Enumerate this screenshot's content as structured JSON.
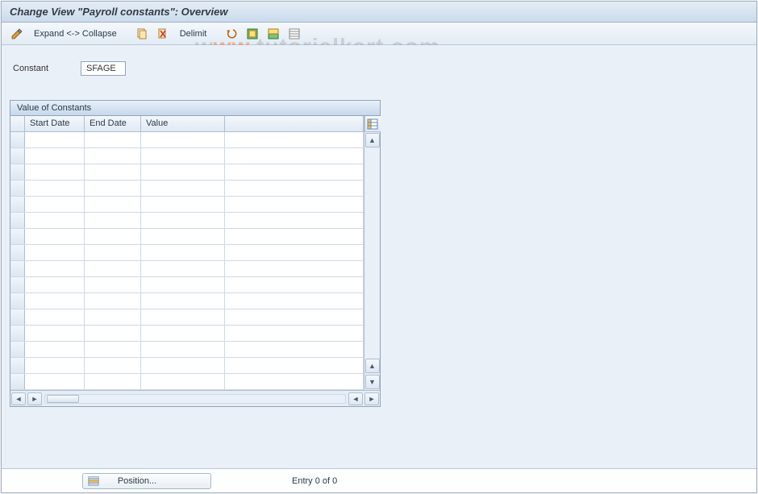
{
  "header": {
    "title": "Change View \"Payroll constants\": Overview"
  },
  "toolbar": {
    "expand_collapse": "Expand <-> Collapse",
    "delimit": "Delimit"
  },
  "field": {
    "constant_label": "Constant",
    "constant_value": "SFAGE"
  },
  "panel": {
    "title": "Value of Constants"
  },
  "table": {
    "columns": {
      "start_date": "Start Date",
      "end_date": "End Date",
      "value": "Value"
    },
    "row_count": 16
  },
  "footer": {
    "position_label": "Position...",
    "entry_text": "Entry 0 of 0"
  },
  "watermark": {
    "text_prefix": "w",
    "text_domain": "torialkart",
    "text_suffix": ".com"
  }
}
